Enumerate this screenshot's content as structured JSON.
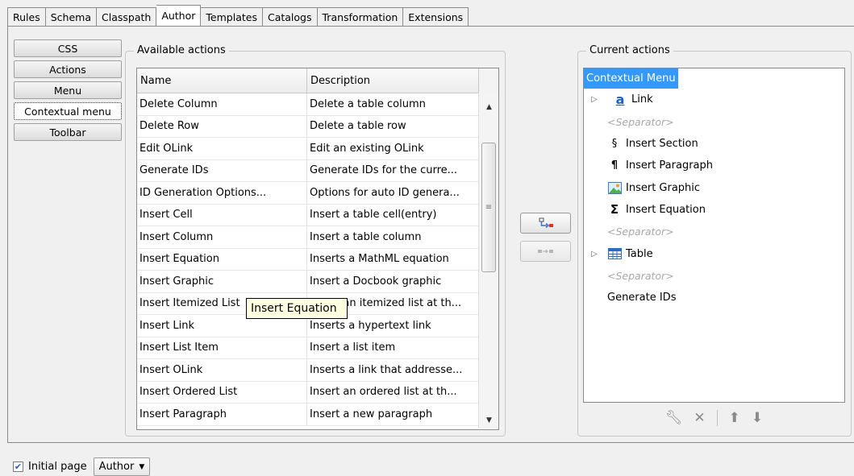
{
  "tabs": [
    "Rules",
    "Schema",
    "Classpath",
    "Author",
    "Templates",
    "Catalogs",
    "Transformation",
    "Extensions"
  ],
  "active_tab": "Author",
  "side_tabs": [
    "CSS",
    "Actions",
    "Menu",
    "Contextual menu",
    "Toolbar"
  ],
  "active_side_tab": "Contextual menu",
  "available": {
    "title": "Available actions",
    "columns": [
      "Name",
      "Description"
    ],
    "rows": [
      [
        "Delete Column",
        "Delete a table column"
      ],
      [
        "Delete Row",
        "Delete a table row"
      ],
      [
        "Edit OLink",
        "Edit an existing OLink"
      ],
      [
        "Generate IDs",
        "Generate IDs for the curre..."
      ],
      [
        "ID Generation Options...",
        "Options for auto ID genera..."
      ],
      [
        "Insert Cell",
        "Insert a table cell(entry)"
      ],
      [
        "Insert Column",
        "Insert a table column"
      ],
      [
        "Insert Equation",
        "Inserts a MathML equation"
      ],
      [
        "Insert Graphic",
        "Insert a Docbook graphic"
      ],
      [
        "Insert Itemized List",
        "Insert an itemized list at th..."
      ],
      [
        "Insert Link",
        "Inserts a hypertext link"
      ],
      [
        "Insert List Item",
        "Insert a list item"
      ],
      [
        "Insert OLink",
        "Inserts a link that addresse..."
      ],
      [
        "Insert Ordered List",
        "Insert an ordered list at th..."
      ],
      [
        "Insert Paragraph",
        "Insert a new paragraph"
      ]
    ],
    "tooltip": "Insert Equation"
  },
  "current": {
    "title": "Current actions",
    "root": "Contextual Menu",
    "items": [
      {
        "label": "Link",
        "icon": "link-a-icon",
        "expandable": true
      },
      {
        "label": "<Separator>",
        "separator": true
      },
      {
        "label": "Insert Section",
        "icon": "section-icon"
      },
      {
        "label": "Insert Paragraph",
        "icon": "pilcrow-icon"
      },
      {
        "label": "Insert Graphic",
        "icon": "image-icon"
      },
      {
        "label": "Insert Equation",
        "icon": "sigma-icon"
      },
      {
        "label": "<Separator>",
        "separator": true
      },
      {
        "label": "Table",
        "icon": "table-icon",
        "expandable": true
      },
      {
        "label": "<Separator>",
        "separator": true
      },
      {
        "label": "Generate IDs"
      }
    ]
  },
  "bottom": {
    "initial_page_label": "Initial page",
    "initial_page_checked": true,
    "initial_page_value": "Author"
  },
  "colors": {
    "selection": "#3399ff",
    "tooltip_bg": "#ffffe1"
  }
}
